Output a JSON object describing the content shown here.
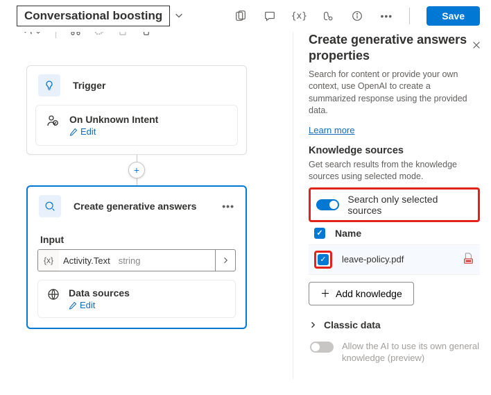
{
  "header": {
    "title": "Conversational boosting",
    "save_label": "Save"
  },
  "canvas": {
    "trigger_label": "Trigger",
    "trigger_event": "On Unknown Intent",
    "edit_label": "Edit",
    "node2_title": "Create generative answers",
    "input_label": "Input",
    "input_var": "Activity.Text",
    "input_type": "string",
    "data_sources_label": "Data sources"
  },
  "panel": {
    "title": "Create generative answers properties",
    "desc": "Search for content or provide your own context, use OpenAI to create a summarized response using the provided data.",
    "learn_more": "Learn more",
    "ks_heading": "Knowledge sources",
    "ks_desc": "Get search results from the knowledge sources using selected mode.",
    "toggle_label": "Search only selected sources",
    "table_header": "Name",
    "file_row": "leave-policy.pdf",
    "add_label": "Add knowledge",
    "classic_label": "Classic data",
    "ai_own_label": "Allow the AI to use its own general knowledge (preview)"
  }
}
